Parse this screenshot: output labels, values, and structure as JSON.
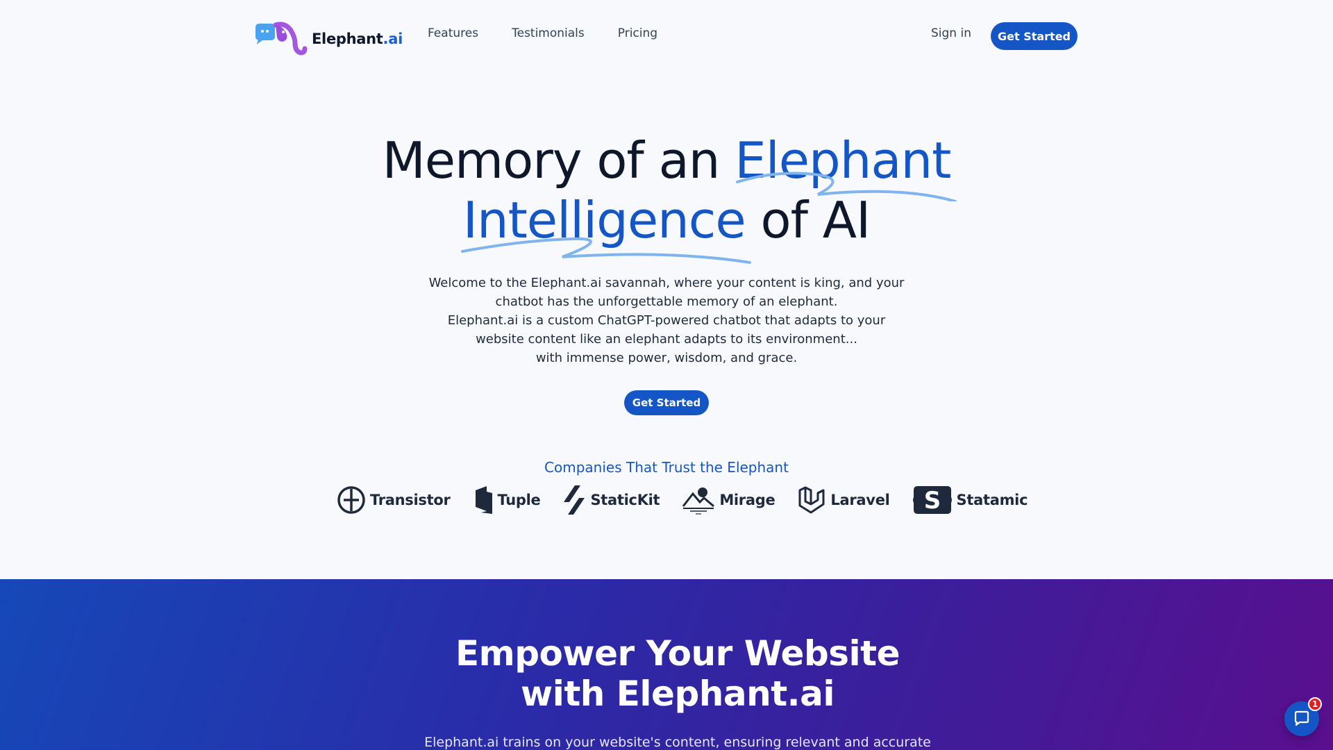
{
  "brand": {
    "name_main": "Elephant",
    "name_accent": ".ai"
  },
  "nav": {
    "links": [
      "Features",
      "Testimonials",
      "Pricing"
    ],
    "signin": "Sign in",
    "cta": "Get Started"
  },
  "hero": {
    "line1_dark": "Memory of an ",
    "line1_accent": "Elephant",
    "line2_accent": "Intelligence",
    "line2_dark": " of AI",
    "description": [
      "Welcome to the Elephant.ai savannah, where your content is king, and your",
      "chatbot has the unforgettable memory of an elephant.",
      "Elephant.ai is a custom ChatGPT-powered chatbot that adapts to your",
      "website content like an elephant adapts to its environment...",
      "with immense power, wisdom, and grace."
    ],
    "cta": "Get Started"
  },
  "trust": {
    "title": "Companies That Trust the Elephant",
    "companies": [
      {
        "name": "Transistor",
        "icon": "transistor-icon"
      },
      {
        "name": "Tuple",
        "icon": "tuple-icon"
      },
      {
        "name": "StaticKit",
        "icon": "statickit-icon"
      },
      {
        "name": "Mirage",
        "icon": "mirage-icon"
      },
      {
        "name": "Laravel",
        "icon": "laravel-icon"
      },
      {
        "name": "Statamic",
        "icon": "statamic-icon"
      }
    ]
  },
  "band": {
    "title_line1": "Empower Your Website",
    "title_line2": "with Elephant.ai",
    "subtitle": "Elephant.ai trains on your website's content, ensuring relevant and accurate"
  },
  "chat": {
    "badge": "1",
    "icon": "chat-bubble-icon"
  },
  "colors": {
    "accent": "#1556c6",
    "swoosh": "#7fb4ee",
    "badge": "#e11d24"
  }
}
